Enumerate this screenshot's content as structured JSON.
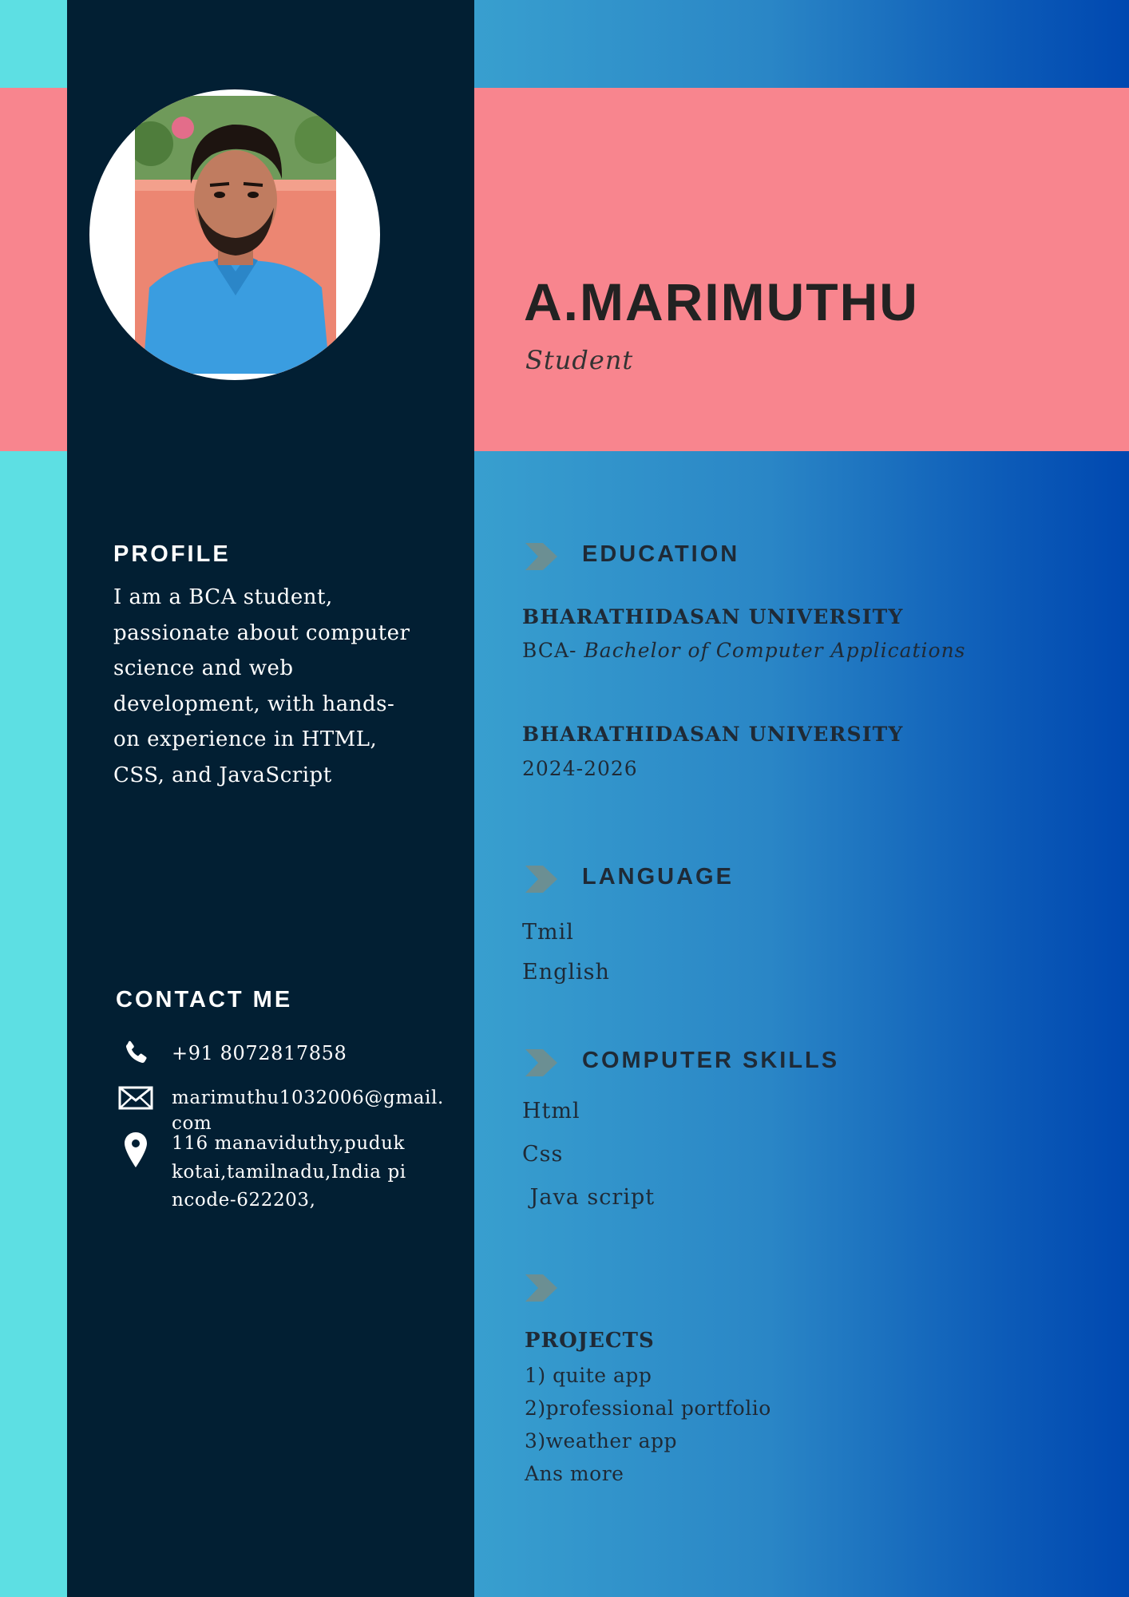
{
  "header": {
    "name": "A.MARIMUTHU",
    "role": "Student"
  },
  "profile": {
    "heading": "PROFILE",
    "text": "I am a BCA student, passionate about computer science and web development, with hands-on experience in HTML, CSS, and JavaScript"
  },
  "contact": {
    "heading": "CONTACT ME",
    "phone": "+91 8072817858",
    "email": "marimuthu1032006@gmail.com",
    "address": "116 manaviduthy,pudukkotai,tamilnadu,India pincode-622203,"
  },
  "education": {
    "heading": "EDUCATION",
    "entries": [
      {
        "institution": "BHARATHIDASAN UNIVERSITY",
        "degree_prefix": "BCA-",
        "degree_name": "Bachelor of Computer Applications"
      },
      {
        "institution": "BHARATHIDASAN UNIVERSITY",
        "years": "2024-2026"
      }
    ]
  },
  "language": {
    "heading": "LANGUAGE",
    "items": [
      "Tmil",
      "English"
    ]
  },
  "skills": {
    "heading": "COMPUTER SKILLS",
    "items": [
      "Html",
      "Css",
      " Java script"
    ]
  },
  "projects": {
    "heading": "PROJECTS",
    "items": [
      "1) quite app",
      "2)professional portfolio",
      "3)weather app",
      "Ans more"
    ]
  },
  "colors": {
    "sidebar": "#021f33",
    "accent_pink": "#f8858e",
    "accent_cyan": "#5ddfe3",
    "gradient_start": "#389fcf",
    "gradient_end": "#0048b0",
    "arrow": "#6b8f93"
  },
  "icons": {
    "phone": "phone-icon",
    "email": "envelope-icon",
    "address": "map-pin-icon",
    "section_marker": "chevron-arrow-icon"
  }
}
